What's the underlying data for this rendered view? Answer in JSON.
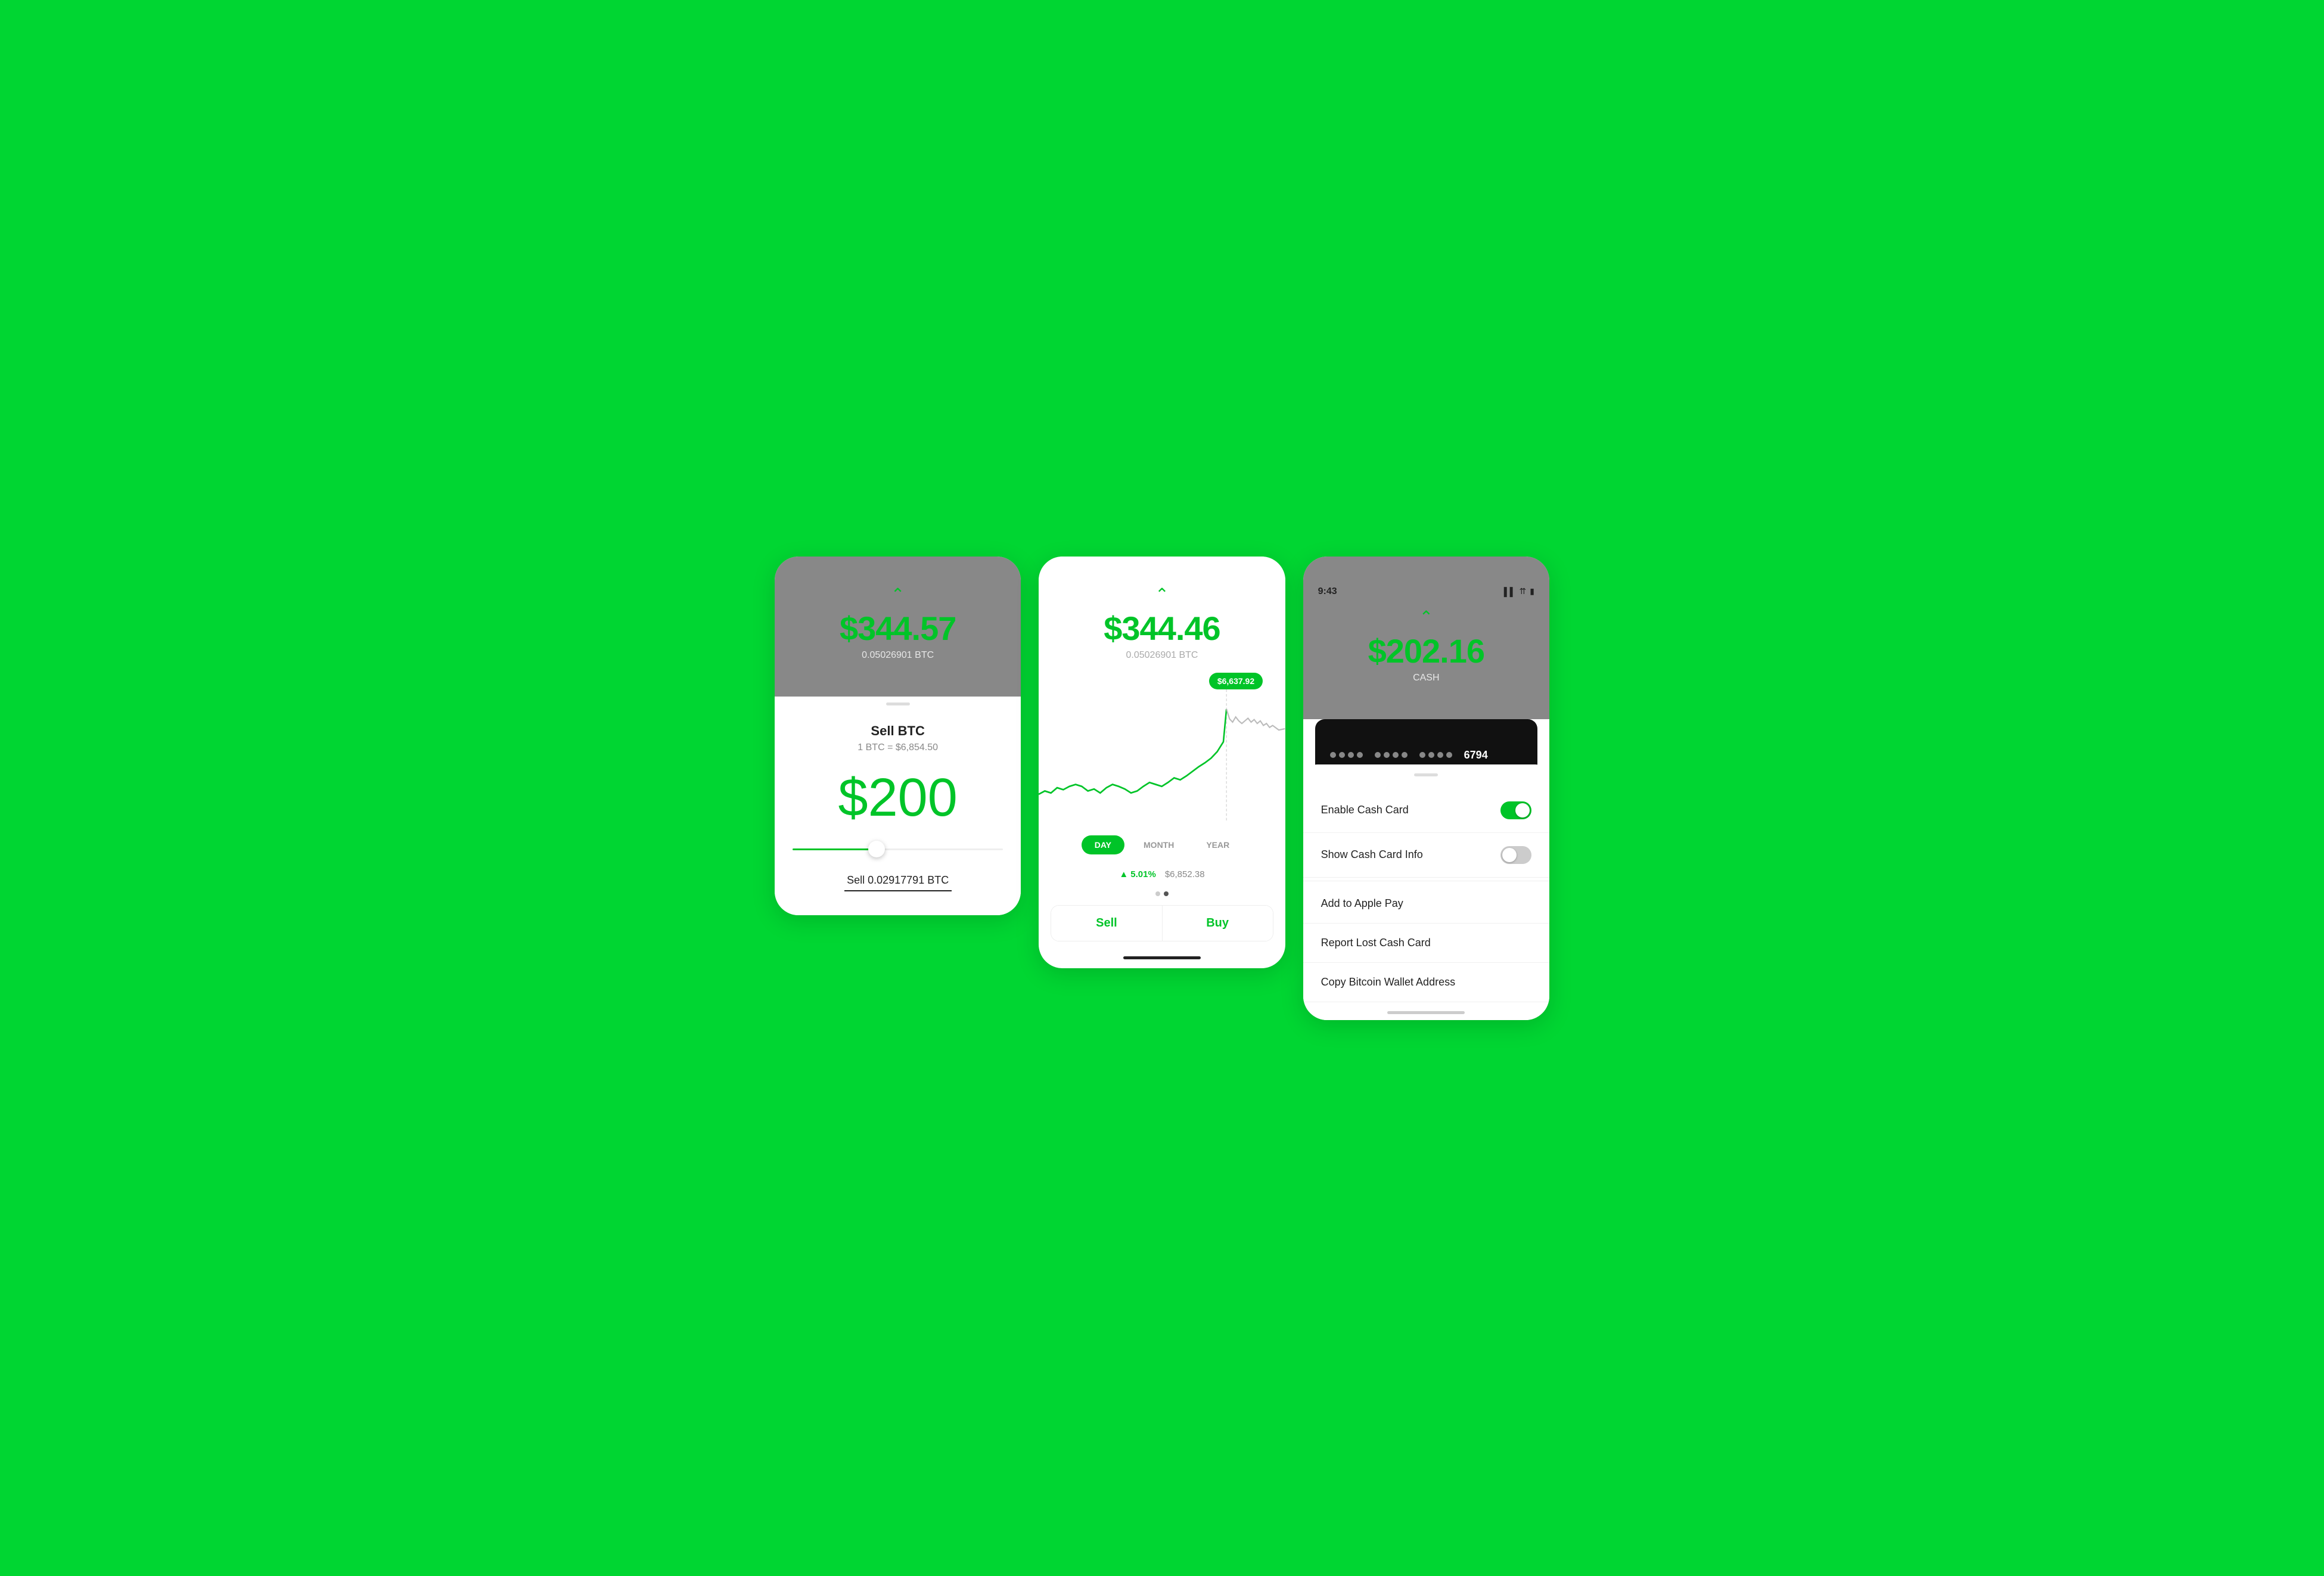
{
  "background_color": "#00D632",
  "screen1": {
    "top": {
      "chevron": "^",
      "price": "$344.57",
      "btc_amount": "0.05026901 BTC"
    },
    "bottom": {
      "title": "Sell BTC",
      "rate": "1 BTC = $6,854.50",
      "amount": "$200",
      "slider_pct": 40,
      "sell_label": "Sell 0.02917791 BTC"
    }
  },
  "screen2": {
    "top": {
      "chevron": "^",
      "price": "$344.46",
      "btc_amount": "0.05026901 BTC"
    },
    "tooltip": "$6,637.92",
    "time_tabs": [
      {
        "label": "DAY",
        "active": true
      },
      {
        "label": "MONTH",
        "active": false
      },
      {
        "label": "YEAR",
        "active": false
      }
    ],
    "stats": {
      "pct": "5.01%",
      "price": "$6,852.38"
    },
    "buttons": [
      {
        "label": "Sell"
      },
      {
        "label": "Buy"
      }
    ]
  },
  "screen3": {
    "status_bar": {
      "time": "9:43",
      "signal": "▌▌",
      "wifi": "WiFi",
      "battery": "Battery"
    },
    "top": {
      "chevron": "^",
      "amount": "$202.16",
      "label": "CASH"
    },
    "card": {
      "last_four": "6794"
    },
    "menu": [
      {
        "id": "enable-cash-card",
        "label": "Enable Cash Card",
        "type": "toggle",
        "toggle_on": true
      },
      {
        "id": "show-cash-card-info",
        "label": "Show Cash Card Info",
        "type": "toggle",
        "toggle_on": false
      },
      {
        "id": "divider1",
        "type": "divider"
      },
      {
        "id": "add-to-apple-pay",
        "label": "Add to Apple Pay",
        "type": "link"
      },
      {
        "id": "report-lost-cash-card",
        "label": "Report Lost Cash Card",
        "type": "link"
      },
      {
        "id": "copy-bitcoin-wallet",
        "label": "Copy Bitcoin Wallet Address",
        "type": "link"
      }
    ]
  }
}
